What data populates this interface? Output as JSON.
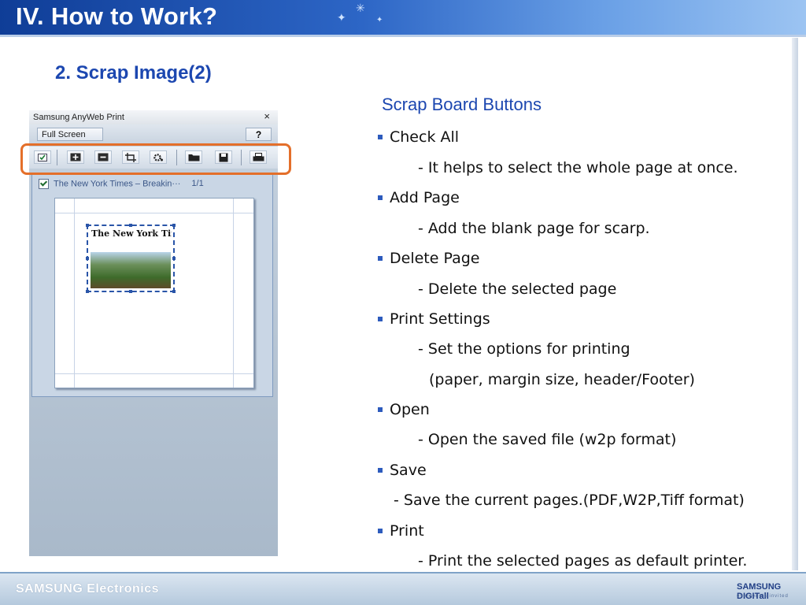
{
  "header": {
    "title": "IV. How to Work?"
  },
  "section_title": "2. Scrap Image(2)",
  "app": {
    "title": "Samsung AnyWeb Print",
    "close_symbol": "×",
    "fullscreen_label": "Full Screen",
    "help_label": "?",
    "toolbar_icons": [
      "check-all-icon",
      "add-page-icon",
      "delete-page-icon",
      "crop-icon",
      "print-settings-icon",
      "open-folder-icon",
      "save-icon",
      "print-icon"
    ],
    "page_title": "The New York Times – Breakin···",
    "page_count": "1/1",
    "clip_logo": "The New York Tim"
  },
  "right": {
    "title": "Scrap Board Buttons",
    "items": [
      {
        "label": "Check All",
        "desc": [
          "- It helps to select the whole page at once."
        ]
      },
      {
        "label": "Add Page",
        "desc": [
          "- Add the blank page for scarp."
        ]
      },
      {
        "label": "Delete Page",
        "desc": [
          "- Delete the selected page"
        ]
      },
      {
        "label": "Print Settings",
        "desc": [
          "- Set the options for printing",
          "(paper, margin size, header/Footer)"
        ]
      },
      {
        "label": "Open",
        "desc": [
          "- Open the saved file (w2p format)"
        ]
      },
      {
        "label": "Save",
        "desc": [
          "- Save the current pages.(PDF,W2P,Tiff format)"
        ]
      },
      {
        "label": "Print",
        "desc": [
          "- Print the selected pages as default printer."
        ]
      }
    ]
  },
  "footer": {
    "left": "SAMSUNG Electronics",
    "right": "SAMSUNG DIGITall",
    "right_sub": "everyone's invited"
  },
  "colors": {
    "accent": "#1c47b0",
    "highlight": "#e46f2a"
  }
}
